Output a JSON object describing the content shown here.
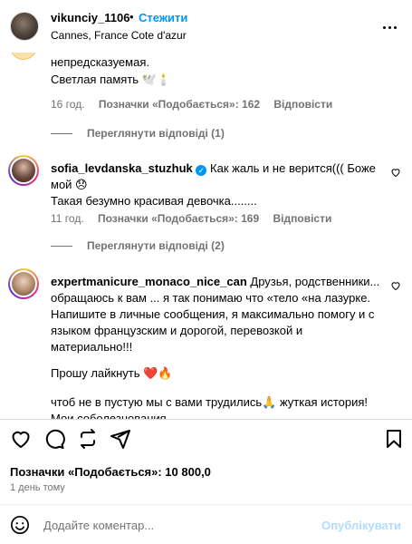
{
  "header": {
    "username": "vikunciy_1106",
    "separator": "•",
    "follow_label": "Стежити",
    "location": "Cannes, France Cote d'azur"
  },
  "comment_top": {
    "line1": "непредсказуемая.",
    "line2": "Светлая память 🕊️🕯️",
    "time": "16 год.",
    "likes": "Позначки «Подобається»: 162",
    "reply": "Відповісти",
    "view_replies": "Переглянути відповіді (1)"
  },
  "comment_sofia": {
    "username": "sofia_levdanska_stuzhuk",
    "text_line1": "Как жаль и не верится((( Боже",
    "text_line2": "мой 😞",
    "text_line3": "Такая безумно красивая девочка........",
    "time": "11 год.",
    "likes": "Позначки «Подобається»: 169",
    "reply": "Відповісти",
    "view_replies": "Переглянути відповіді (2)"
  },
  "comment_expert": {
    "username": "expertmanicure_monaco_nice_can",
    "text_line1": "Друзья, родственники...",
    "text_line2": "обращаюсь к вам ... я так понимаю что «тело «на лазурке.",
    "text_line3": "Напишите в личные сообщения, я максимально помогу и с",
    "text_line4": "языком французским и дорогой, перевозкой и",
    "text_line5": "материально!!!",
    "text_line6": "Прошу лайкнуть ❤️🔥",
    "text_line7": "чтоб не в пустую мы с вами трудились🙏 жуткая история!",
    "text_line8": "Мои соболезнования"
  },
  "post": {
    "likes": "Позначки «Подобається»: 10 800,0",
    "time": "1 день тому"
  },
  "comment_input": {
    "placeholder": "Додайте коментар...",
    "publish_label": "Опублікувати"
  }
}
